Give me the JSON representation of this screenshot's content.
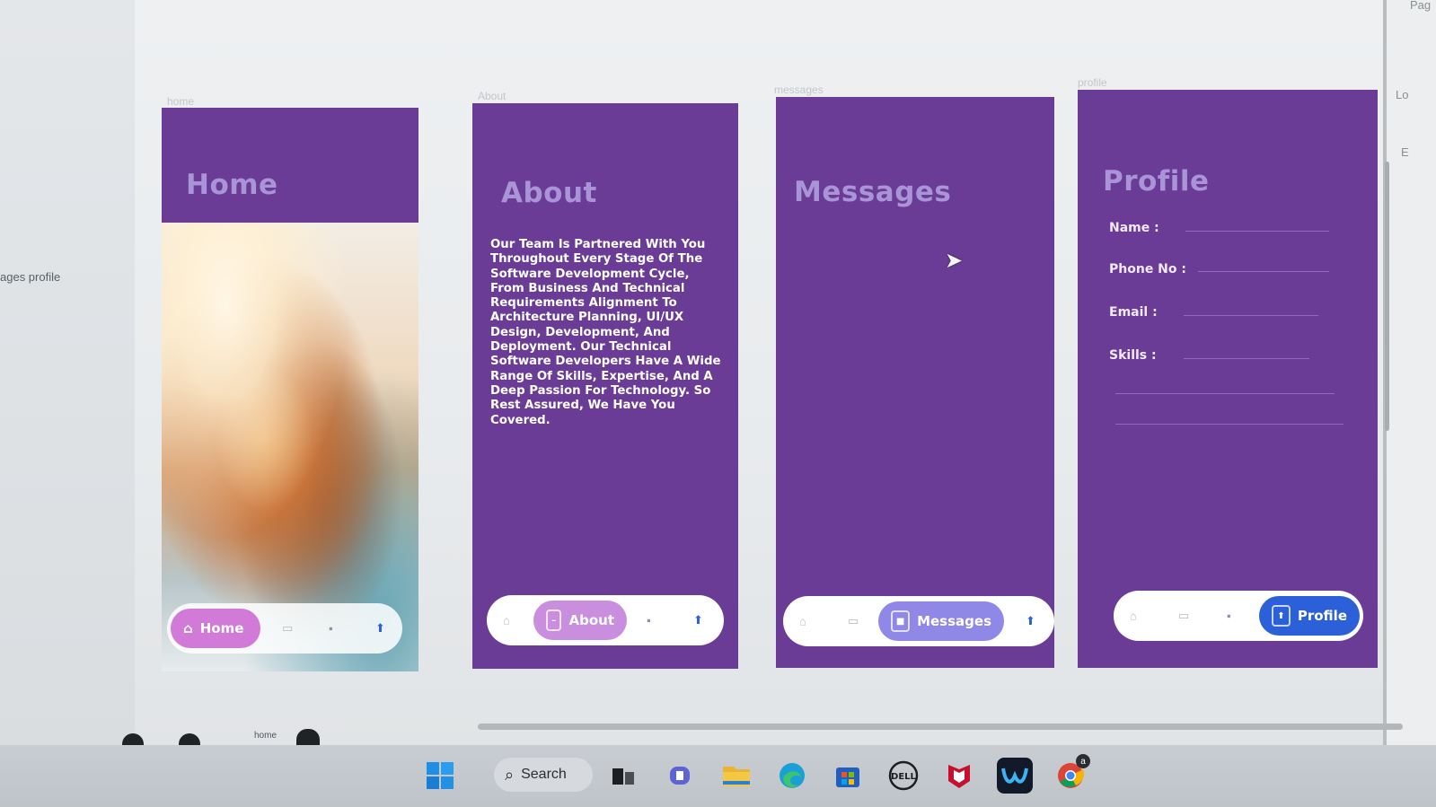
{
  "left_panel": {
    "label": "ages profile"
  },
  "right_panel": {
    "labels": [
      "Pag",
      "Lo",
      "E"
    ]
  },
  "frames": {
    "home": {
      "label": "home",
      "title": "Home",
      "nav": {
        "active": "Home"
      }
    },
    "about": {
      "label": "About",
      "title": "About",
      "body": "Our Team Is Partnered With You Throughout Every Stage Of The Software Development Cycle, From Business And Technical Requirements Alignment To Architecture Planning, UI/UX Design, Development, And Deployment. Our Technical Software Developers Have A Wide Range Of Skills, Expertise, And A Deep Passion For Technology. So Rest Assured, We Have You Covered.",
      "nav": {
        "active": "About"
      }
    },
    "messages": {
      "label": "messages",
      "title": "Messages",
      "nav": {
        "active": "Messages"
      }
    },
    "profile": {
      "label": "profile",
      "title": "Profile",
      "fields": [
        "Name :",
        "Phone No :",
        "Email :",
        "Skills :"
      ],
      "nav": {
        "active": "Profile"
      }
    }
  },
  "bottom_label": "home",
  "taskbar": {
    "search_label": "Search",
    "apps": [
      "start-icon",
      "task-view-icon",
      "teams-icon",
      "file-explorer-icon",
      "edge-icon",
      "store-icon",
      "dell-icon",
      "mcafee-icon",
      "webex-icon",
      "chrome-icon"
    ],
    "chrome_badge": "a"
  },
  "colors": {
    "frame_purple": "#6a3c95",
    "title_lavender": "#a994d8",
    "home_pill": "#d27ad8",
    "about_pill": "#c98fde",
    "messages_pill": "#8f88e6",
    "profile_pill": "#2b60d9"
  }
}
